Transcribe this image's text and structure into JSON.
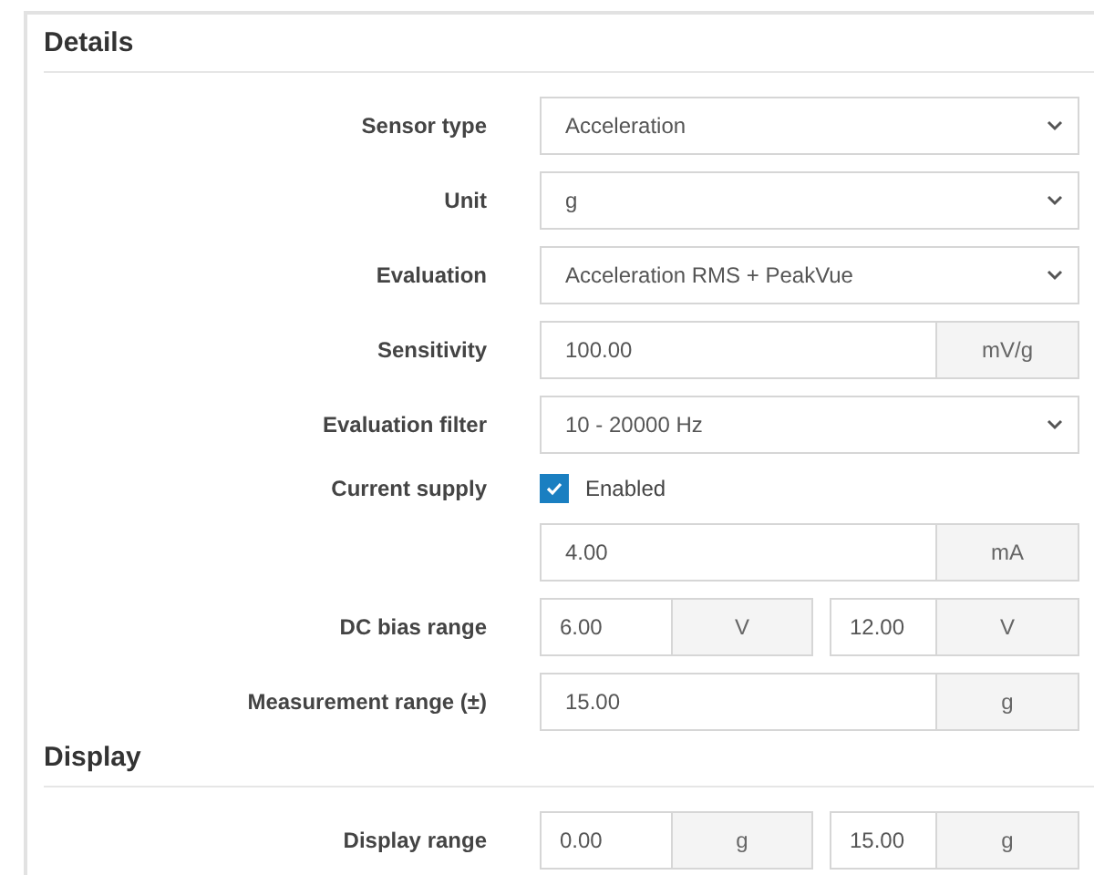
{
  "sections": [
    {
      "title": "Details",
      "rows": [
        {
          "label": "Sensor type",
          "kind": "select",
          "value": "Acceleration"
        },
        {
          "label": "Unit",
          "kind": "select",
          "value": "g"
        },
        {
          "label": "Evaluation",
          "kind": "select",
          "value": "Acceleration RMS + PeakVue"
        },
        {
          "label": "Sensitivity",
          "kind": "input",
          "value": "100.00",
          "unit": "mV/g"
        },
        {
          "label": "Evaluation filter",
          "kind": "select",
          "value": "10 - 20000 Hz"
        },
        {
          "label": "Current supply",
          "kind": "checkbox",
          "text": "Enabled",
          "checked": true
        },
        {
          "kind": "input",
          "value": "4.00",
          "unit": "mA"
        },
        {
          "label": "DC bias range",
          "kind": "range",
          "fields": [
            {
              "value": "6.00",
              "unit": "V"
            },
            {
              "value": "12.00",
              "unit": "V"
            }
          ]
        },
        {
          "label": "Measurement range (±)",
          "kind": "input",
          "value": "15.00",
          "unit": "g"
        }
      ]
    },
    {
      "title": "Display",
      "rows": [
        {
          "label": "Display range",
          "kind": "range",
          "fields": [
            {
              "value": "0.00",
              "unit": "g"
            },
            {
              "value": "15.00",
              "unit": "g"
            }
          ]
        }
      ]
    }
  ]
}
